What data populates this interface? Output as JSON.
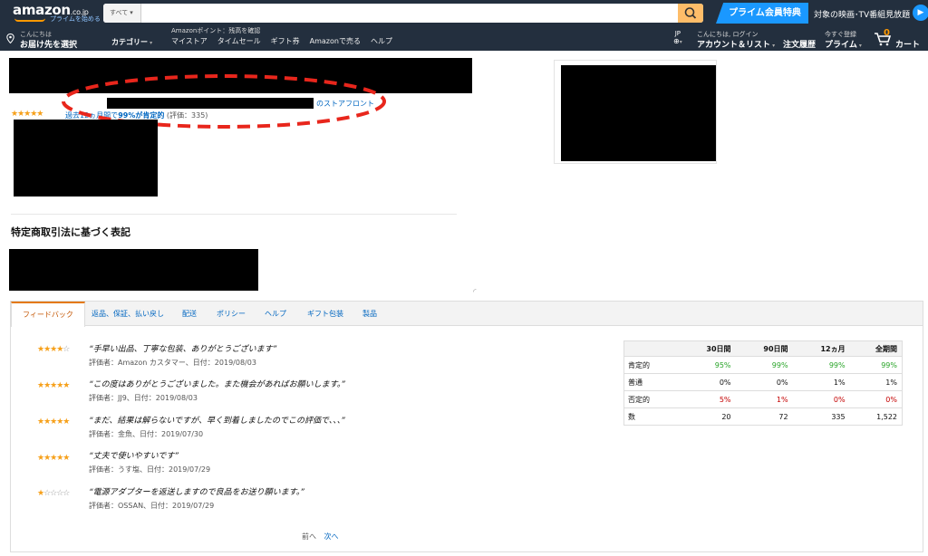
{
  "header": {
    "logo_text": "amazon",
    "logo_domain": ".co.jp",
    "logo_sub": "プライムを始める",
    "search_category": "すべて",
    "search_value": "",
    "prime_banner": "プライム会員特典",
    "prime_video": "対象の映画･TV番組見放題"
  },
  "nav": {
    "location_line1": "こんにちは",
    "location_line2": "お届け先を選択",
    "categories": "カテゴリー",
    "points": "Amazonポイント：残高を確認",
    "links": [
      "マイストア",
      "タイムセール",
      "ギフト券",
      "Amazonで売る",
      "ヘルプ"
    ],
    "lang": "JP",
    "account_line1": "こんにちは, ログイン",
    "account_line2": "アカウント＆リスト",
    "orders": "注文履歴",
    "prime_line1": "今すぐ登録",
    "prime_line2": "プライム",
    "cart_count": "0",
    "cart_label": "カート"
  },
  "seller": {
    "rating_stars": 5,
    "summary_prefix": "過去12ヵ月間で",
    "summary_bold": "99%が肯定的",
    "summary_count": "(評価：335)",
    "storefront": "のストアフロント",
    "legal_title": "特定商取引法に基づく表記"
  },
  "tabs": [
    "フィードバック",
    "返品、保証、払い戻し",
    "配送",
    "ポリシー",
    "ヘルプ",
    "ギフト包装",
    "製品"
  ],
  "reviews": [
    {
      "stars": 4,
      "quote": "“手早い出品、丁寧な包装、ありがとうございます”",
      "meta": "評価者：Amazon カスタマー、日付：2019/08/03"
    },
    {
      "stars": 5,
      "quote": "“この度はありがとうございました。また機会があればお願いします。”",
      "meta": "評価者：JJ9、日付：2019/08/03"
    },
    {
      "stars": 5,
      "quote": "“まだ、結果は解らないですが、早く到着しましたのでこの評価で、、、”",
      "meta": "評価者：金魚、日付：2019/07/30"
    },
    {
      "stars": 5,
      "quote": "“丈夫で使いやすいです”",
      "meta": "評価者：うす塩、日付：2019/07/29"
    },
    {
      "stars": 1,
      "quote": "“電源アダプターを返送しますので良品をお送り願います。”",
      "meta": "評価者：OSSAN、日付：2019/07/29"
    }
  ],
  "pager": {
    "prev": "前へ",
    "next": "次へ"
  },
  "rating_table": {
    "headers": [
      "",
      "30日間",
      "90日間",
      "12ヵ月",
      "全期間"
    ],
    "rows": [
      {
        "label": "肯定的",
        "values": [
          "95%",
          "99%",
          "99%",
          "99%"
        ],
        "color": "#28a428"
      },
      {
        "label": "普通",
        "values": [
          "0%",
          "0%",
          "1%",
          "1%"
        ],
        "color": "#111111"
      },
      {
        "label": "否定的",
        "values": [
          "5%",
          "1%",
          "0%",
          "0%"
        ],
        "color": "#c40000"
      },
      {
        "label": "数",
        "values": [
          "20",
          "72",
          "335",
          "1,522"
        ],
        "color": "#111111"
      }
    ]
  },
  "colors": {
    "nav_bg": "#232f3e",
    "accent_orange": "#ff9900",
    "link_blue": "#0066c0",
    "prime_blue": "#1a98ff",
    "annotation_red": "#e8261c"
  }
}
